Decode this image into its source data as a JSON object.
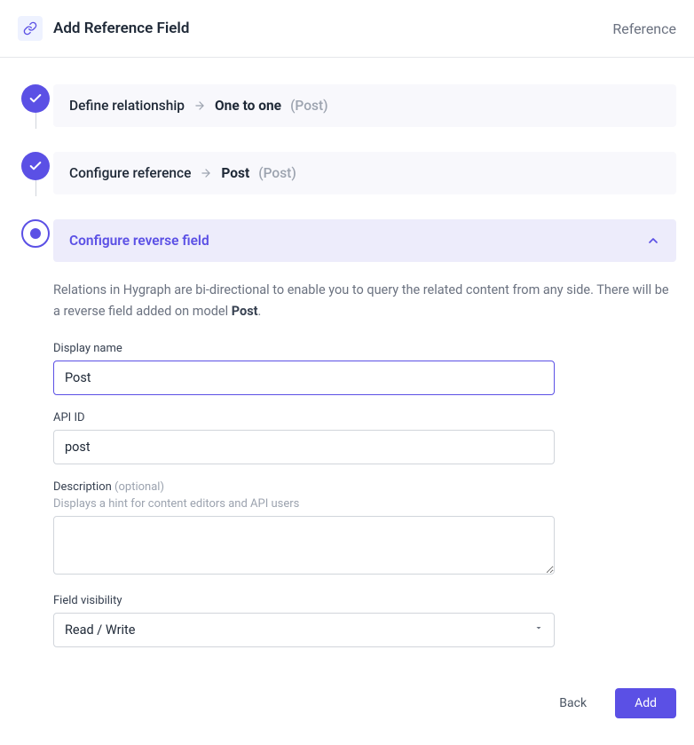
{
  "header": {
    "title": "Add Reference Field",
    "type_label": "Reference"
  },
  "steps": {
    "s1": {
      "label": "Define relationship",
      "value": "One to one",
      "context": "(Post)"
    },
    "s2": {
      "label": "Configure reference",
      "value": "Post",
      "context": "(Post)"
    },
    "s3": {
      "label": "Configure reverse field"
    }
  },
  "panel": {
    "helper_pre": "Relations in Hygraph are bi-directional to enable you to query the related content from any side. There will be a reverse field added on model ",
    "helper_bold": "Post",
    "helper_post": "."
  },
  "form": {
    "display_name": {
      "label": "Display name",
      "value": "Post"
    },
    "api_id": {
      "label": "API ID",
      "value": "post"
    },
    "description": {
      "label": "Description",
      "optional": "(optional)",
      "hint": "Displays a hint for content editors and API users",
      "value": ""
    },
    "visibility": {
      "label": "Field visibility",
      "value": "Read / Write"
    }
  },
  "footer": {
    "back": "Back",
    "add": "Add"
  }
}
